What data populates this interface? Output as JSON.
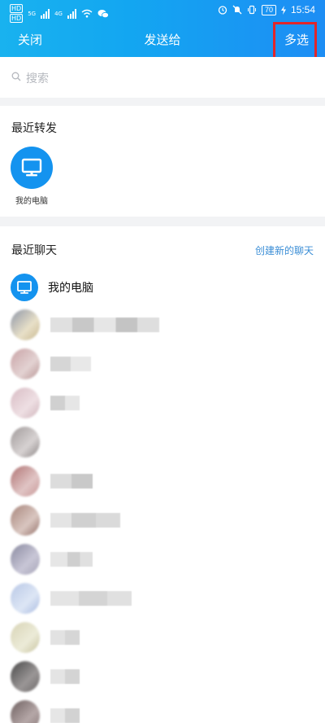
{
  "status_bar": {
    "sim1": "HD",
    "sim2": "HD",
    "net1": "5G",
    "net2": "4G",
    "battery": "70",
    "time": "15:54"
  },
  "header": {
    "close_label": "关闭",
    "title": "发送给",
    "multi_select_label": "多选"
  },
  "search": {
    "placeholder": "搜索"
  },
  "recent_forward": {
    "title": "最近转发",
    "items": [
      {
        "label": "我的电脑",
        "icon": "monitor-icon"
      }
    ]
  },
  "recent_chats": {
    "title": "最近聊天",
    "create_label": "创建新的聊天",
    "first_item": {
      "name": "我的电脑",
      "icon": "monitor-icon"
    }
  },
  "colors": {
    "accent": "#1493ef",
    "highlight_box": "#e2262a",
    "link": "#3b8ed6"
  }
}
